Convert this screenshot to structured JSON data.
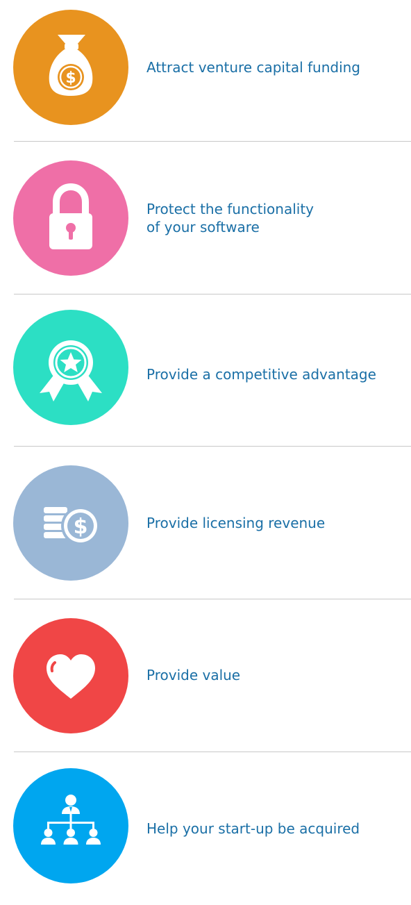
{
  "items": [
    {
      "label": "Attract venture capital funding",
      "icon": "money-bag-icon",
      "color": "#e8931f"
    },
    {
      "label": "Protect the functionality\nof your software",
      "icon": "padlock-icon",
      "color": "#ef6fa7"
    },
    {
      "label": "Provide a competitive advantage",
      "icon": "award-ribbon-icon",
      "color": "#2cdfc4"
    },
    {
      "label": "Provide licensing revenue",
      "icon": "coins-dollar-icon",
      "color": "#9ab7d6"
    },
    {
      "label": "Provide value",
      "icon": "heart-icon",
      "color": "#f04646"
    },
    {
      "label": "Help your start-up be acquired",
      "icon": "org-chart-icon",
      "color": "#00a6ef"
    }
  ]
}
